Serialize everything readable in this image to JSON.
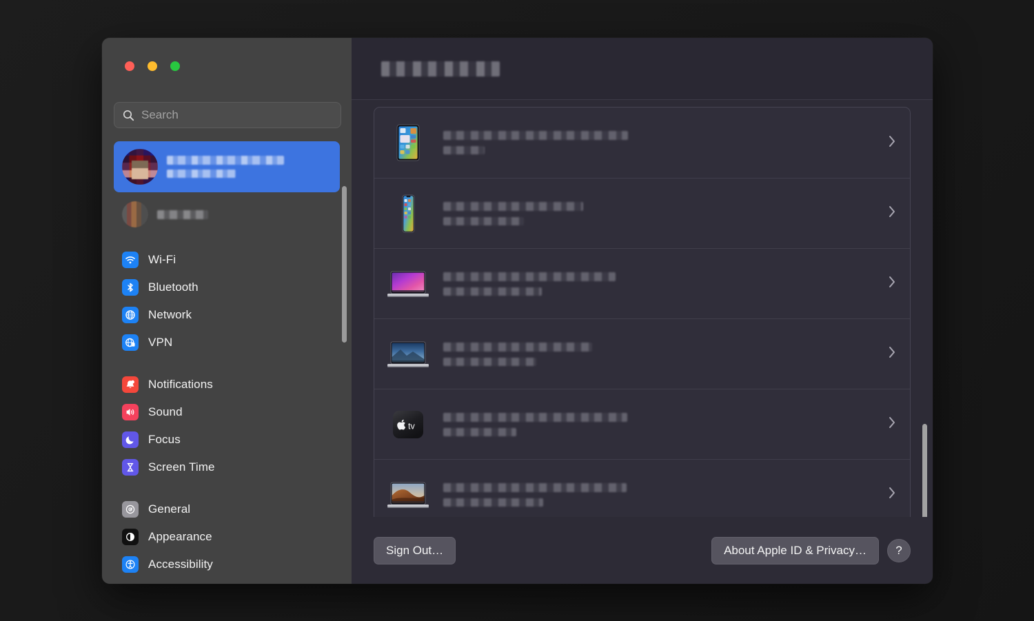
{
  "window": {
    "traffic_lights": [
      {
        "name": "close",
        "color": "#ff5f57"
      },
      {
        "name": "minimize",
        "color": "#febc2e"
      },
      {
        "name": "zoom",
        "color": "#28c840"
      }
    ]
  },
  "sidebar": {
    "search": {
      "placeholder": "Search",
      "value": ""
    },
    "account": {
      "primary": {
        "name_redacted": true,
        "subtitle_redacted": true,
        "selected": true
      },
      "secondary": {
        "name_redacted": true
      }
    },
    "groups": [
      {
        "items": [
          {
            "label": "Wi-Fi",
            "icon": "wifi-icon",
            "color": "#1d82f5"
          },
          {
            "label": "Bluetooth",
            "icon": "bluetooth-icon",
            "color": "#1d82f5"
          },
          {
            "label": "Network",
            "icon": "network-globe-icon",
            "color": "#1d82f5"
          },
          {
            "label": "VPN",
            "icon": "vpn-globe-icon",
            "color": "#1d82f5"
          }
        ]
      },
      {
        "items": [
          {
            "label": "Notifications",
            "icon": "notifications-bell-icon",
            "color": "#f4473b"
          },
          {
            "label": "Sound",
            "icon": "sound-speaker-icon",
            "color": "#f4415c"
          },
          {
            "label": "Focus",
            "icon": "focus-moon-icon",
            "color": "#6157e8"
          },
          {
            "label": "Screen Time",
            "icon": "screen-time-hourglass-icon",
            "color": "#6157e8"
          }
        ]
      },
      {
        "items": [
          {
            "label": "General",
            "icon": "general-gear-icon",
            "color": "#98979d"
          },
          {
            "label": "Appearance",
            "icon": "appearance-contrast-icon",
            "color": "#111111"
          },
          {
            "label": "Accessibility",
            "icon": "accessibility-person-icon",
            "color": "#1d82f5"
          }
        ]
      }
    ]
  },
  "content": {
    "header": {
      "title_redacted": true
    },
    "devices": [
      {
        "icon": "ipad-icon",
        "name_redacted": true,
        "detail_redacted": true,
        "name_width": 268,
        "detail_width": 60
      },
      {
        "icon": "iphone-icon",
        "name_redacted": true,
        "detail_redacted": true,
        "name_width": 203,
        "detail_width": 117
      },
      {
        "icon": "macbook-monterey-icon",
        "name_redacted": true,
        "detail_redacted": true,
        "name_width": 250,
        "detail_width": 143
      },
      {
        "icon": "macbook-catalina-icon",
        "name_redacted": true,
        "detail_redacted": true,
        "name_width": 216,
        "detail_width": 135
      },
      {
        "icon": "apple-tv-icon",
        "name_redacted": true,
        "detail_redacted": true,
        "name_width": 267,
        "detail_width": 106
      },
      {
        "icon": "macbook-mojave-icon",
        "name_redacted": true,
        "detail_redacted": true,
        "name_width": 266,
        "detail_width": 145
      }
    ],
    "chevron_glyph": "›",
    "footer": {
      "sign_out_label": "Sign Out…",
      "about_label": "About Apple ID & Privacy…",
      "help_label": "?"
    }
  }
}
